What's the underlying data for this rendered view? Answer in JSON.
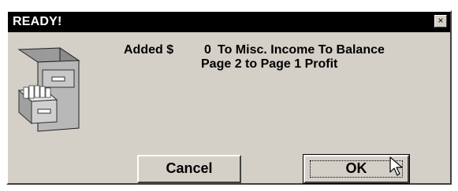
{
  "window": {
    "title": "READY!",
    "close_glyph": "×"
  },
  "message": {
    "prefix": "Added $",
    "amount": "0",
    "line1_rest": "To Misc. Income To Balance",
    "line2": "Page 2 to Page 1 Profit"
  },
  "buttons": {
    "cancel_label": "Cancel",
    "ok_label": "OK"
  },
  "icons": {
    "main": "file-cabinet-icon",
    "cursor": "mouse-pointer-icon",
    "close": "close-icon"
  },
  "colors": {
    "titlebar": "#000000",
    "dialog_bg": "#d4d0c8",
    "text": "#000000"
  }
}
